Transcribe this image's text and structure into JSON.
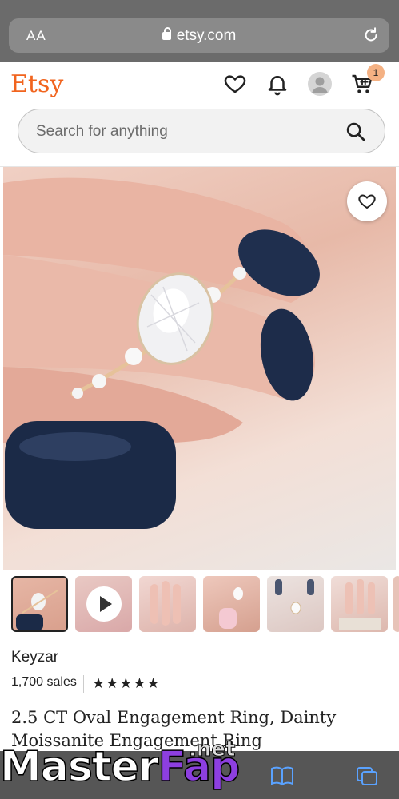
{
  "browser": {
    "text_size_label": "AA",
    "url": "etsy.com"
  },
  "header": {
    "logo": "Etsy",
    "cart_count": "1"
  },
  "search": {
    "placeholder": "Search for anything",
    "value": ""
  },
  "listing": {
    "shop_name": "Keyzar",
    "sales": "1,700 sales",
    "rating": "★★★★★",
    "rating_value": 5,
    "title": "2.5 CT Oval Engagement Ring, Dainty Moissanite Engagement Ring"
  },
  "colors": {
    "brand": "#f1641e",
    "badge": "#f4b183"
  },
  "icons": {
    "favorite": "heart-icon",
    "notifications": "bell-icon",
    "account": "avatar-icon",
    "cart": "cart-icon",
    "search": "search-icon",
    "reload": "reload-icon",
    "play": "play-icon",
    "bookmarks": "book-icon",
    "tabs": "tabs-icon"
  },
  "watermark": {
    "part1": "Master",
    "part2": "Fap",
    "suffix": ".net"
  }
}
